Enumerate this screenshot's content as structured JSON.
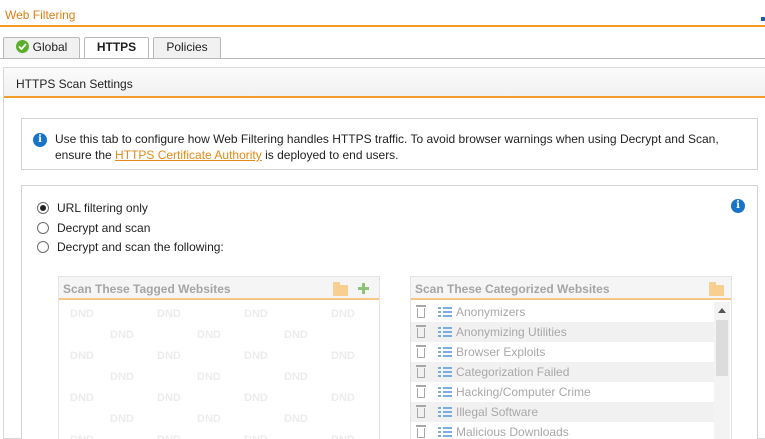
{
  "app": {
    "title": "Web Filtering"
  },
  "tabs": [
    {
      "label": "Global",
      "icon": "check-icon",
      "active": false
    },
    {
      "label": "HTTPS",
      "active": true
    },
    {
      "label": "Policies",
      "active": false
    }
  ],
  "section": {
    "title": "HTTPS Scan Settings"
  },
  "info": {
    "text_before": "Use this tab to configure how Web Filtering handles HTTPS traffic. To avoid browser warnings when using Decrypt and Scan, ensure the ",
    "link": "HTTPS Certificate Authority",
    "text_after": " is deployed to end users."
  },
  "options": [
    {
      "label": "URL filtering only",
      "selected": true
    },
    {
      "label": "Decrypt and scan",
      "selected": false
    },
    {
      "label": "Decrypt and scan the following:",
      "selected": false
    }
  ],
  "tagged_panel": {
    "title": "Scan These Tagged Websites",
    "placeholder": "DND"
  },
  "categorized_panel": {
    "title": "Scan These Categorized Websites",
    "items": [
      "Anonymizers",
      "Anonymizing Utilities",
      "Browser Exploits",
      "Categorization Failed",
      "Hacking/Computer Crime",
      "Illegal Software",
      "Malicious Downloads"
    ]
  },
  "colors": {
    "accent": "#f29c2b",
    "link": "#e28a15",
    "info": "#1774c9",
    "check": "#5aae2a"
  }
}
